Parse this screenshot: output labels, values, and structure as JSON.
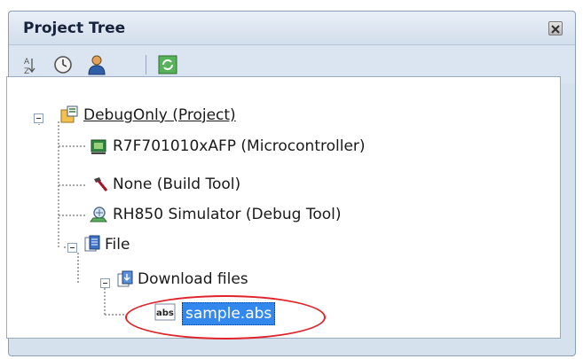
{
  "panel": {
    "title": "Project Tree",
    "close_icon": "close-icon"
  },
  "toolbar": {
    "buttons": [
      {
        "icon": "sort-icon"
      },
      {
        "icon": "clock-icon"
      },
      {
        "icon": "person-icon"
      },
      {
        "icon": "refresh-icon"
      }
    ]
  },
  "tree": {
    "project": "DebugOnly (Project)",
    "microcontroller": "R7F701010xAFP (Microcontroller)",
    "build_tool": "None (Build Tool)",
    "debug_tool": "RH850 Simulator (Debug Tool)",
    "file": "File",
    "download_files": "Download files",
    "selected_file": "sample.abs",
    "abs_icon_text": "abs"
  },
  "colors": {
    "selection": "#3388ee",
    "highlight": "#e0242b"
  }
}
